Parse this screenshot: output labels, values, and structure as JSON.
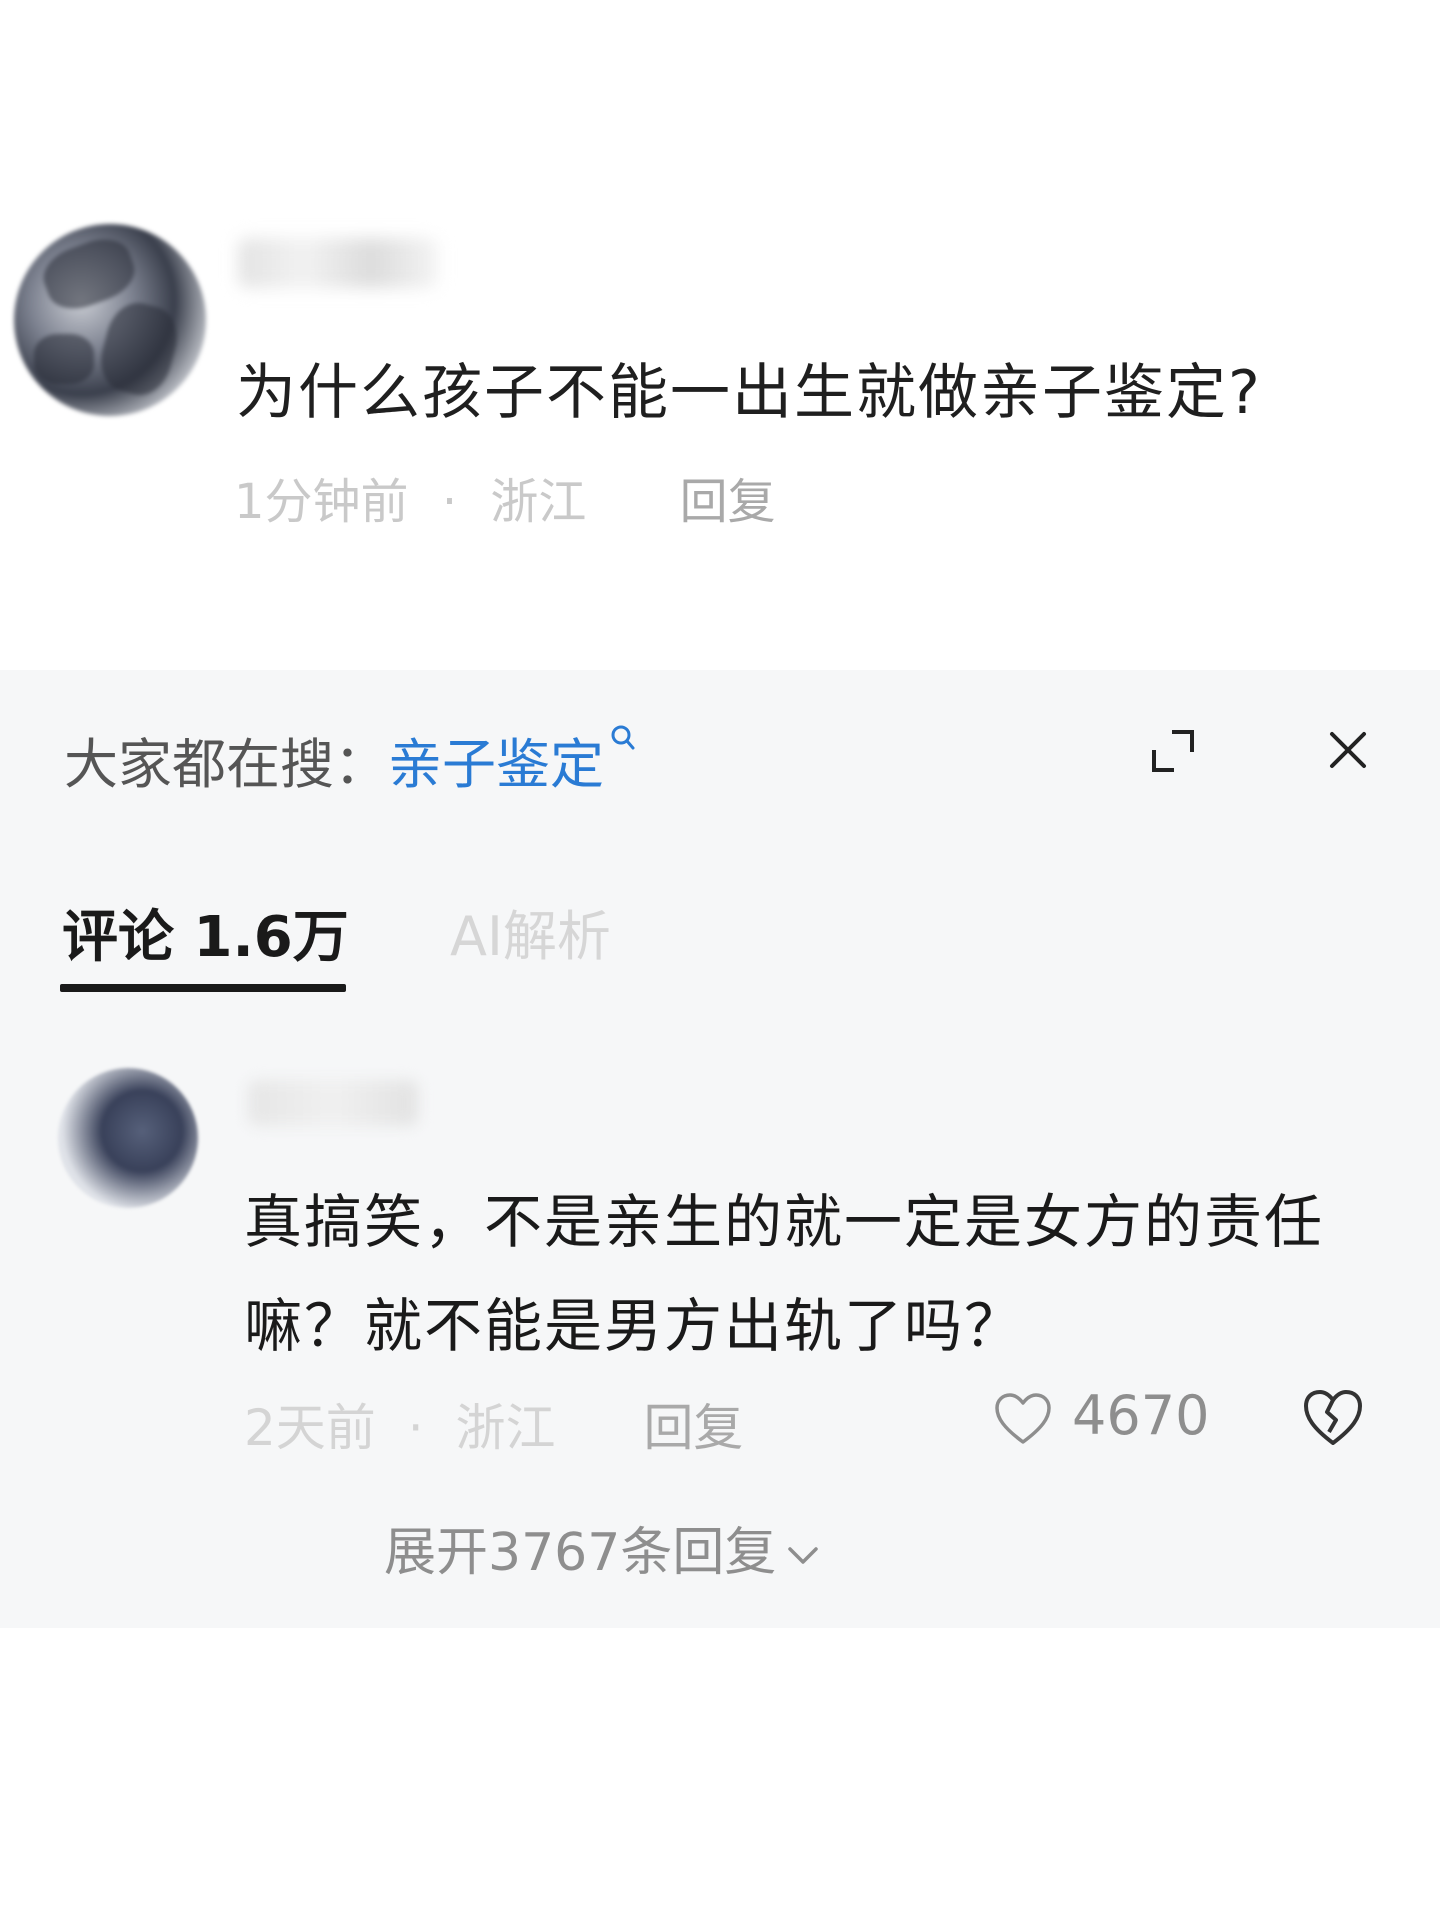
{
  "top_comment": {
    "question": "为什么孩子不能一出生就做亲子鉴定?",
    "time": "1分钟前",
    "separator": "·",
    "location": "浙江",
    "reply": "回复"
  },
  "search_bar": {
    "prefix": "大家都在搜：",
    "keyword": "亲子鉴定"
  },
  "tabs": {
    "comments_label": "评论",
    "comments_count": "1.6万",
    "ai_label": "AI解析"
  },
  "comment": {
    "text": "真搞笑，不是亲生的就一定是女方的责任嘛？就不能是男方出轨了吗？",
    "time": "2天前",
    "separator": "·",
    "location": "浙江",
    "reply": "回复",
    "likes": "4670",
    "expand_replies": "展开3767条回复"
  },
  "colors": {
    "accent_blue": "#2a7bd4",
    "text_dark": "#1a1a1a",
    "meta_gray": "#c9c9c9",
    "panel_bg": "#f6f7f8"
  },
  "icons": [
    "search-icon",
    "expand-icon",
    "close-icon",
    "heart-icon",
    "broken-heart-icon",
    "chevron-down-icon"
  ]
}
